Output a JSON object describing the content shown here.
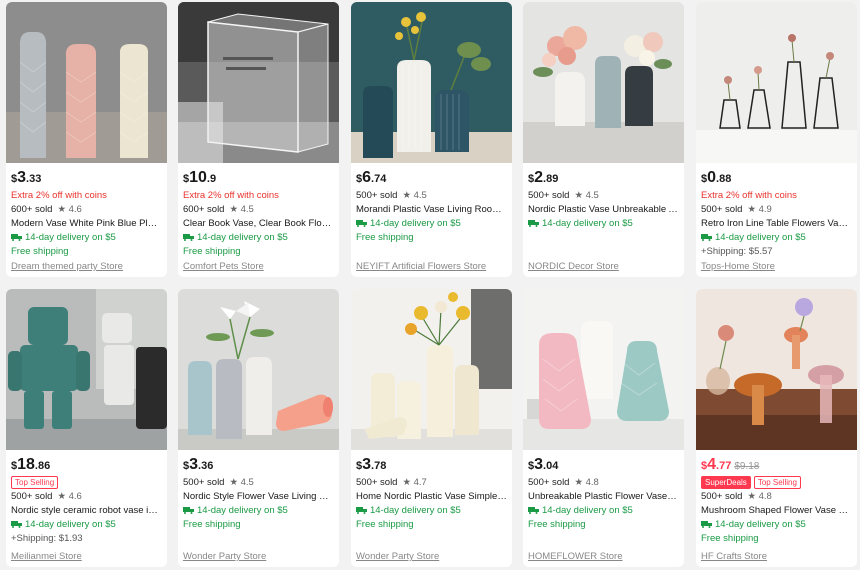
{
  "colors": {
    "price_sale": "#fd384f",
    "coins": "#e8322c",
    "delivery": "#1a9a44",
    "store": "#888888"
  },
  "icons": {
    "delivery": "truck-icon",
    "rating": "star-icon"
  },
  "products": [
    {
      "price_sym": "$",
      "price_int": "3",
      "price_dec": ".33",
      "coins": "Extra 2% off with coins",
      "sold": "600+ sold",
      "rating": "★ 4.6",
      "title": "Modern Vase White Pink Blue Plasti...",
      "delivery": "14-day delivery on $5",
      "shipping": "Free shipping",
      "store": "Dream themed party Store"
    },
    {
      "price_sym": "$",
      "price_int": "10",
      "price_dec": ".9",
      "coins": "Extra 2% off with coins",
      "sold": "600+ sold",
      "rating": "★ 4.5",
      "title": "Clear Book Vase, Clear Book Flower...",
      "delivery": "14-day delivery on $5",
      "shipping": "Free shipping",
      "store": "Comfort Pets Store"
    },
    {
      "price_sym": "$",
      "price_int": "6",
      "price_dec": ".74",
      "sold": "500+ sold",
      "rating": "★ 4.5",
      "title": "Morandi Plastic Vase Living Room ...",
      "delivery": "14-day delivery on $5",
      "shipping": "Free shipping",
      "store": "NEYIFT Artificial Flowers Store"
    },
    {
      "price_sym": "$",
      "price_int": "2",
      "price_dec": ".89",
      "sold": "500+ sold",
      "rating": "★ 4.5",
      "title": "Nordic Plastic Vase Unbreakable A-...",
      "delivery": "14-day delivery on $5",
      "store": "NORDIC Decor Store"
    },
    {
      "price_sym": "$",
      "price_int": "0",
      "price_dec": ".88",
      "coins": "Extra 2% off with coins",
      "sold": "500+ sold",
      "rating": "★ 4.9",
      "title": "Retro Iron Line Table Flowers Vases-...",
      "delivery": "14-day delivery on $5",
      "shipping_cost": "+Shipping: $5.57",
      "store": "Tops-Home Store"
    },
    {
      "price_sym": "$",
      "price_int": "18",
      "price_dec": ".86",
      "badge": "Top Selling",
      "sold": "500+ sold",
      "rating": "★ 4.6",
      "title": "Nordic style ceramic robot vase ind...",
      "delivery": "14-day delivery on $5",
      "shipping_cost": "+Shipping: $1.93",
      "store": "Meilianmei Store"
    },
    {
      "price_sym": "$",
      "price_int": "3",
      "price_dec": ".36",
      "sold": "500+ sold",
      "rating": "★ 4.5",
      "title": "Nordic Style Flower Vase Living Roo...",
      "delivery": "14-day delivery on $5",
      "shipping": "Free shipping",
      "store": "Wonder Party Store"
    },
    {
      "price_sym": "$",
      "price_int": "3",
      "price_dec": ".78",
      "sold": "500+ sold",
      "rating": "★ 4.7",
      "title": "Home Nordic Plastic Vase Simple S...",
      "delivery": "14-day delivery on $5",
      "shipping": "Free shipping",
      "store": "Wonder Party Store"
    },
    {
      "price_sym": "$",
      "price_int": "3",
      "price_dec": ".04",
      "sold": "500+ sold",
      "rating": "★ 4.8",
      "title": "Unbreakable Plastic Flower Vase D...",
      "delivery": "14-day delivery on $5",
      "shipping": "Free shipping",
      "store": "HOMEFLOWER Store"
    },
    {
      "price_sym": "$",
      "price_int": "4",
      "price_dec": ".77",
      "orig_price": "$9.18",
      "superdeals": "SuperDeals",
      "badge": "Top Selling",
      "sold": "500+ sold",
      "rating": "★ 4.8",
      "title": "Mushroom Shaped Flower Vase Tr...",
      "delivery": "14-day delivery on $5",
      "shipping": "Free shipping",
      "store": "HF Crafts Store"
    }
  ]
}
